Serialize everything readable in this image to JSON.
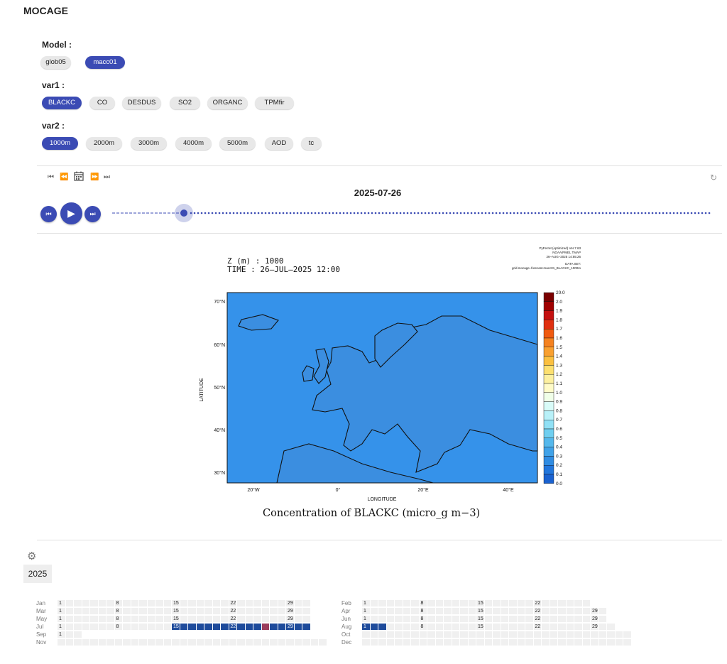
{
  "app": {
    "title": "MOCAGE"
  },
  "model": {
    "label": "Model :",
    "options": [
      "glob05",
      "macc01"
    ],
    "selected": "macc01"
  },
  "var1": {
    "label": "var1 :",
    "options": [
      "BLACKC",
      "CO",
      "DESDUS",
      "SO2",
      "ORGANC",
      "TPMfir"
    ],
    "selected": "BLACKC"
  },
  "var2": {
    "label": "var2 :",
    "options": [
      "1000m",
      "2000m",
      "3000m",
      "4000m",
      "5000m",
      "AOD",
      "tc"
    ],
    "selected": "1000m"
  },
  "player": {
    "current_date": "2025-07-26",
    "mini_controls": [
      "first-icon",
      "rewind-icon",
      "calendar-icon",
      "fast-forward-icon",
      "last-icon"
    ],
    "refresh_icon": "refresh-icon",
    "timeline_progress_percent": 12,
    "accent_color": "#3b4bb4"
  },
  "map": {
    "header_left_line1": "Z (m) : 1000",
    "header_left_line2": "TIME : 26–JUL–2025 12:00",
    "header_right_line1": "PyFerret (optimized) Ver.7.63",
    "header_right_line2": "NOAA/PMEL TMAP",
    "header_right_line3": "26–AUG–2025 14:55:26",
    "header_right_line4": "DATA SET:",
    "header_right_line5": "grid.mocage–forecast.macc01_BLACKC_1000m",
    "ylabel": "LATITUDE",
    "xlabel": "LONGITUDE",
    "lat_ticks": [
      "70°N",
      "60°N",
      "50°N",
      "40°N",
      "30°N"
    ],
    "lon_ticks": [
      "20°W",
      "0°",
      "20°E",
      "40°E"
    ],
    "colorbar_labels": [
      "20.0",
      "2.0",
      "1.9",
      "1.8",
      "1.7",
      "1.6",
      "1.5",
      "1.4",
      "1.3",
      "1.2",
      "1.1",
      "1.0",
      "0.9",
      "0.8",
      "0.7",
      "0.6",
      "0.5",
      "0.4",
      "0.3",
      "0.2",
      "0.1",
      "0.0"
    ],
    "caption": "Concentration of BLACKC (micro_g m−3)"
  },
  "calendar": {
    "settings_icon": "gear-icon",
    "year": "2025",
    "highlight_color": "#1e4b9b",
    "current_color": "#9b3d5c",
    "left_months": [
      {
        "name": "Jan",
        "days": 31,
        "start": 0,
        "end": 0
      },
      {
        "name": "Mar",
        "days": 31,
        "start": 0,
        "end": 0
      },
      {
        "name": "May",
        "days": 31,
        "start": 0,
        "end": 0
      },
      {
        "name": "Jul",
        "days": 31,
        "start": 15,
        "end": 31,
        "current": 26
      },
      {
        "name": "Sep",
        "days": 3,
        "start": 0,
        "end": 0
      },
      {
        "name": "Nov",
        "days": 0,
        "start": 0,
        "end": 0
      }
    ],
    "right_months": [
      {
        "name": "Feb",
        "days": 28,
        "start": 0,
        "end": 0
      },
      {
        "name": "Apr",
        "days": 30,
        "start": 0,
        "end": 0
      },
      {
        "name": "Jun",
        "days": 30,
        "start": 0,
        "end": 0
      },
      {
        "name": "Aug",
        "days": 31,
        "start": 1,
        "end": 3
      },
      {
        "name": "Oct",
        "days": 0,
        "start": 0,
        "end": 0
      },
      {
        "name": "Dec",
        "days": 0,
        "start": 0,
        "end": 0
      }
    ],
    "labeled_days": [
      1,
      8,
      15,
      22,
      29
    ]
  }
}
